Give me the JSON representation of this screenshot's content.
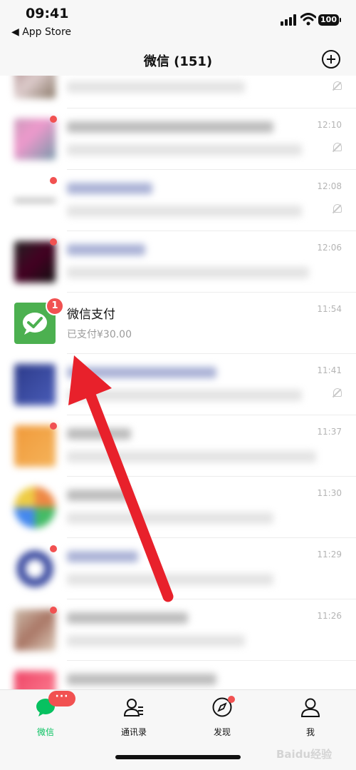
{
  "status_bar": {
    "time": "09:41",
    "back_app": "◀ App Store",
    "battery": "100"
  },
  "header": {
    "title": "微信 (151)"
  },
  "chats": [
    {
      "time": ""
    },
    {
      "time": "12:10"
    },
    {
      "time": "12:08"
    },
    {
      "time": "12:06"
    },
    {
      "name": "微信支付",
      "preview": "已支付¥30.00",
      "time": "11:54",
      "badge": "1"
    },
    {
      "time": "11:41"
    },
    {
      "time": "11:37"
    },
    {
      "time": "11:30"
    },
    {
      "time": "11:29"
    },
    {
      "time": "11:26"
    }
  ],
  "tabbar": {
    "chats_label": "微信",
    "contacts_label": "通讯录",
    "discover_label": "发现",
    "me_label": "我",
    "chats_badge": "···"
  },
  "watermark": "Baidu经验",
  "colors": {
    "accent": "#07c160",
    "badge": "#f15151",
    "arrow": "#e8212b"
  }
}
